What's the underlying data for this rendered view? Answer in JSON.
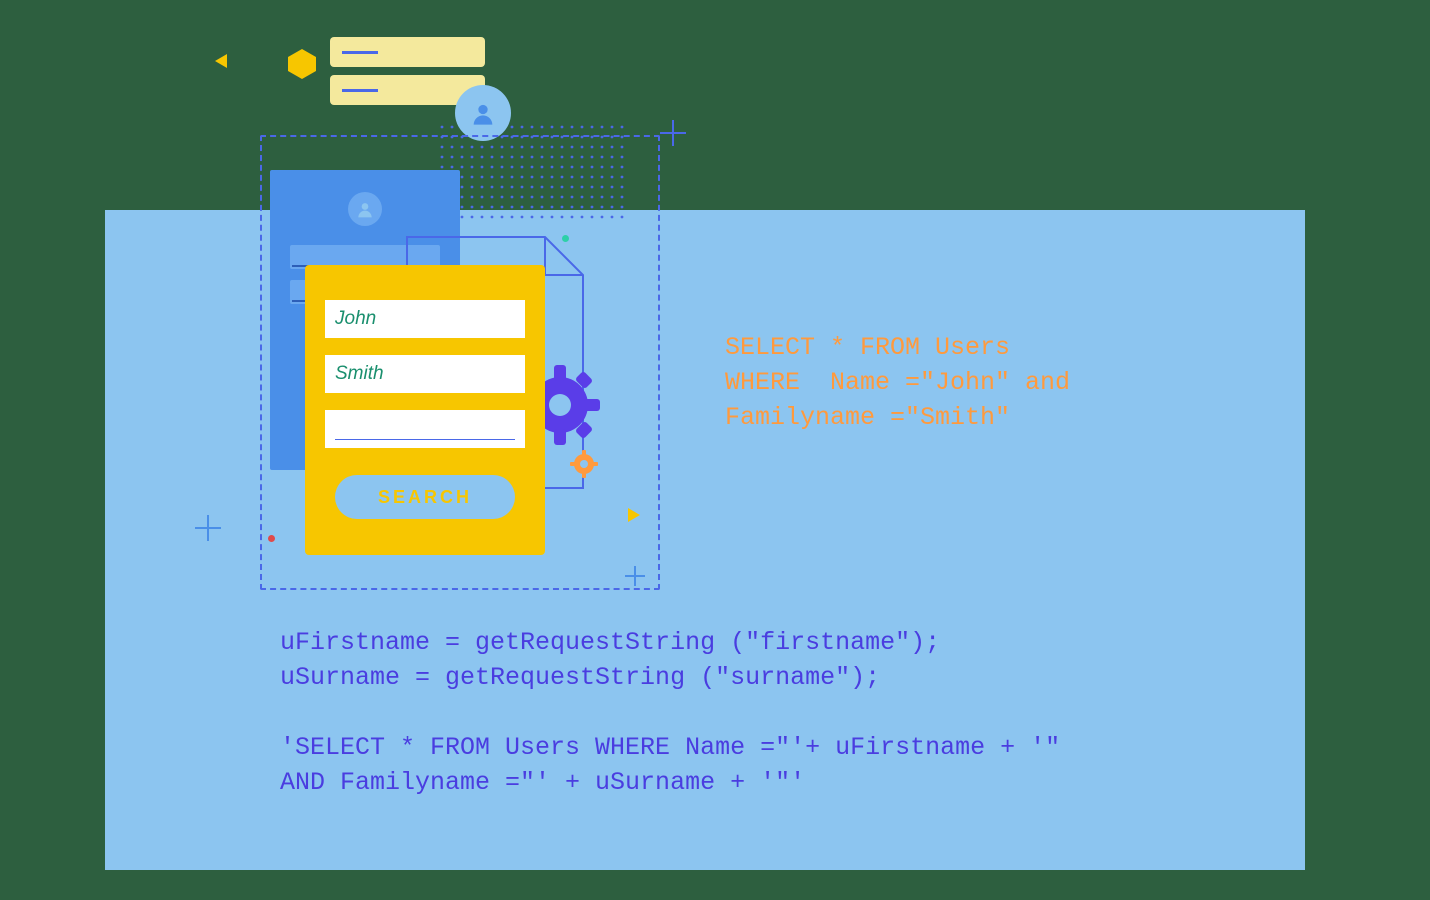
{
  "form": {
    "first_name_value": "John",
    "surname_value": "Smith",
    "search_label": "SEARCH"
  },
  "sql": {
    "line1": "SELECT * FROM Users",
    "line2": "WHERE  Name =\"John\" and",
    "line3": "Familyname =\"Smith\""
  },
  "code": {
    "line1": "uFirstname = getRequestString (\"firstname\");",
    "line2": "uSurname = getRequestString (\"surname\");",
    "line3": "",
    "line4": "'SELECT * FROM Users WHERE Name =\"'+ uFirstname + '\"",
    "line5": "AND Familyname =\"' + uSurname + '\"'"
  },
  "icons": {
    "avatar": "avatar-icon",
    "gear": "gear-icon",
    "hex": "hexagon-icon"
  }
}
